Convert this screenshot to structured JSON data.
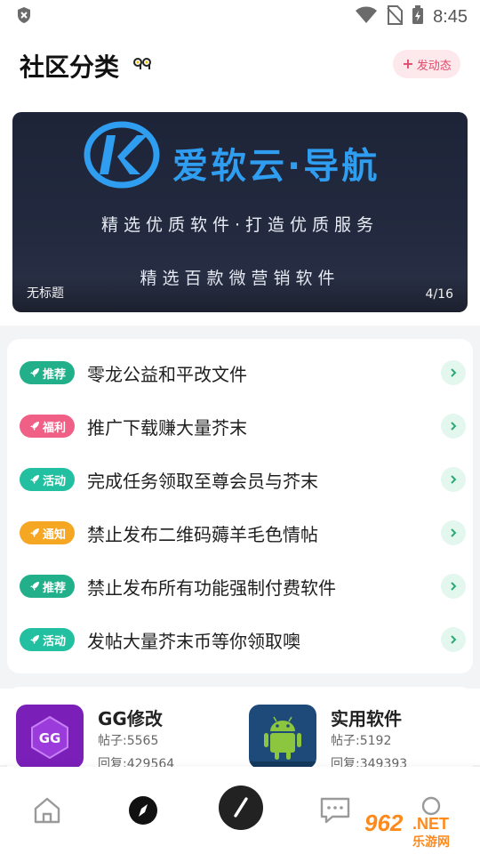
{
  "status_bar": {
    "time": "8:45",
    "icons": [
      "shield-icon",
      "wifi-icon",
      "no-sim-icon",
      "battery-charging-icon"
    ]
  },
  "header": {
    "title": "社区分类",
    "post_button_plus": "+",
    "post_button_label": "发动态",
    "accent_color": "#e24b6a"
  },
  "banner": {
    "brand": "爱软云·导航",
    "tagline": "精选优质软件·打造优质服务",
    "subline": "精选百款微营销软件",
    "caption": "无标题",
    "counter": "4/16"
  },
  "announcements": [
    {
      "tag": "推荐",
      "tag_color": "#22b08a",
      "title": "零龙公益和平改文件"
    },
    {
      "tag": "福利",
      "tag_color": "#ef5f86",
      "title": "推广下载赚大量芥末"
    },
    {
      "tag": "活动",
      "tag_color": "#22c0a0",
      "title": "完成任务领取至尊会员与芥末"
    },
    {
      "tag": "通知",
      "tag_color": "#f5a623",
      "title": "禁止发布二维码薅羊毛色情帖"
    },
    {
      "tag": "推荐",
      "tag_color": "#22b08a",
      "title": "禁止发布所有功能强制付费软件"
    },
    {
      "tag": "活动",
      "tag_color": "#22c0a0",
      "title": "发帖大量芥末币等你领取噢"
    }
  ],
  "categories": [
    {
      "name": "GG修改",
      "posts": "帖子:5565",
      "replies": "回复:429564",
      "icon": "gg-icon"
    },
    {
      "name": "实用软件",
      "posts": "帖子:5192",
      "replies": "回复:349393",
      "icon": "android-icon"
    }
  ],
  "bottom_nav": {
    "items": [
      "home-icon",
      "discover-icon",
      "compose-icon",
      "message-icon",
      "profile-icon"
    ]
  },
  "watermark": {
    "number": "962",
    "domain": ".NET",
    "name": "乐游网"
  }
}
